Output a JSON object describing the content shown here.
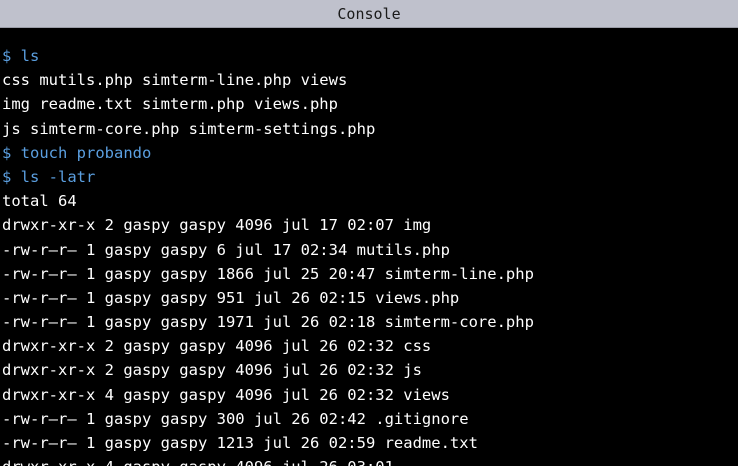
{
  "window": {
    "title": "Console"
  },
  "colors": {
    "background": "#000000",
    "titlebar": "#bfc1cc",
    "output_text": "#ffffff",
    "command_text": "#5b9fe0"
  },
  "terminal": {
    "lines": [
      {
        "type": "command",
        "text": "$ ls"
      },
      {
        "type": "output",
        "text": "css mutils.php simterm-line.php views"
      },
      {
        "type": "output",
        "text": "img readme.txt simterm.php views.php"
      },
      {
        "type": "output",
        "text": "js simterm-core.php simterm-settings.php"
      },
      {
        "type": "command",
        "text": "$ touch probando"
      },
      {
        "type": "command",
        "text": "$ ls -latr"
      },
      {
        "type": "output",
        "text": "total 64"
      },
      {
        "type": "output",
        "text": "drwxr-xr-x 2 gaspy gaspy 4096 jul 17 02:07 img"
      },
      {
        "type": "output",
        "text": "-rw-r–r– 1 gaspy gaspy 6 jul 17 02:34 mutils.php"
      },
      {
        "type": "output",
        "text": "-rw-r–r– 1 gaspy gaspy 1866 jul 25 20:47 simterm-line.php"
      },
      {
        "type": "output",
        "text": "-rw-r–r– 1 gaspy gaspy 951 jul 26 02:15 views.php"
      },
      {
        "type": "output",
        "text": "-rw-r–r– 1 gaspy gaspy 1971 jul 26 02:18 simterm-core.php"
      },
      {
        "type": "output",
        "text": "drwxr-xr-x 2 gaspy gaspy 4096 jul 26 02:32 css"
      },
      {
        "type": "output",
        "text": "drwxr-xr-x 2 gaspy gaspy 4096 jul 26 02:32 js"
      },
      {
        "type": "output",
        "text": "drwxr-xr-x 4 gaspy gaspy 4096 jul 26 02:32 views"
      },
      {
        "type": "output",
        "text": "-rw-r–r– 1 gaspy gaspy 300 jul 26 02:42 .gitignore"
      },
      {
        "type": "output",
        "text": "-rw-r–r– 1 gaspy gaspy 1213 jul 26 02:59 readme.txt"
      },
      {
        "type": "output",
        "text": "drwxr-xr-x 4 gaspy gaspy 4096 jul 26 03:01"
      }
    ]
  }
}
